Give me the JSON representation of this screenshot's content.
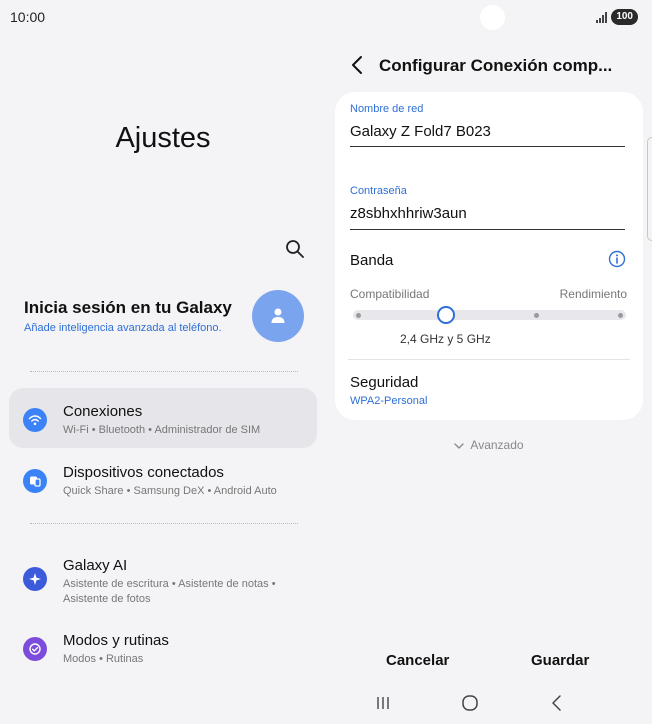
{
  "status_bar": {
    "time": "10:00",
    "battery": "100"
  },
  "settings": {
    "title": "Ajustes",
    "account": {
      "title": "Inicia sesión en tu Galaxy",
      "subtitle": "Añade inteligencia avanzada al teléfono."
    },
    "items": [
      {
        "title": "Conexiones",
        "subtitle": "Wi-Fi  •  Bluetooth  •  Administrador de SIM",
        "icon": "wifi-icon",
        "color": "#3b82f6",
        "selected": true
      },
      {
        "title": "Dispositivos conectados",
        "subtitle": "Quick Share  •  Samsung DeX  •  Android Auto",
        "icon": "devices-icon",
        "color": "#3b82f6"
      },
      {
        "title": "Galaxy AI",
        "subtitle": "Asistente de escritura  •  Asistente de notas  •  Asistente de fotos",
        "icon": "sparkle-icon",
        "color": "#3b5bdb"
      },
      {
        "title": "Modos y rutinas",
        "subtitle": "Modos  •  Rutinas",
        "icon": "check-circle-icon",
        "color": "#7c4ddb"
      }
    ]
  },
  "hotspot": {
    "title": "Configurar Conexión comp...",
    "network_name_label": "Nombre de red",
    "network_name": "Galaxy Z Fold7 B023",
    "password_label": "Contraseña",
    "password": "z8sbhxhhriw3aun",
    "band_label": "Banda",
    "band_left": "Compatibilidad",
    "band_right": "Rendimiento",
    "band_value": "2,4 GHz y 5 GHz",
    "band_level": 0.33,
    "security_label": "Seguridad",
    "security_value": "WPA2-Personal",
    "advanced_label": "Avanzado",
    "cancel_label": "Cancelar",
    "save_label": "Guardar"
  },
  "accent_color": "#2f6fd6"
}
